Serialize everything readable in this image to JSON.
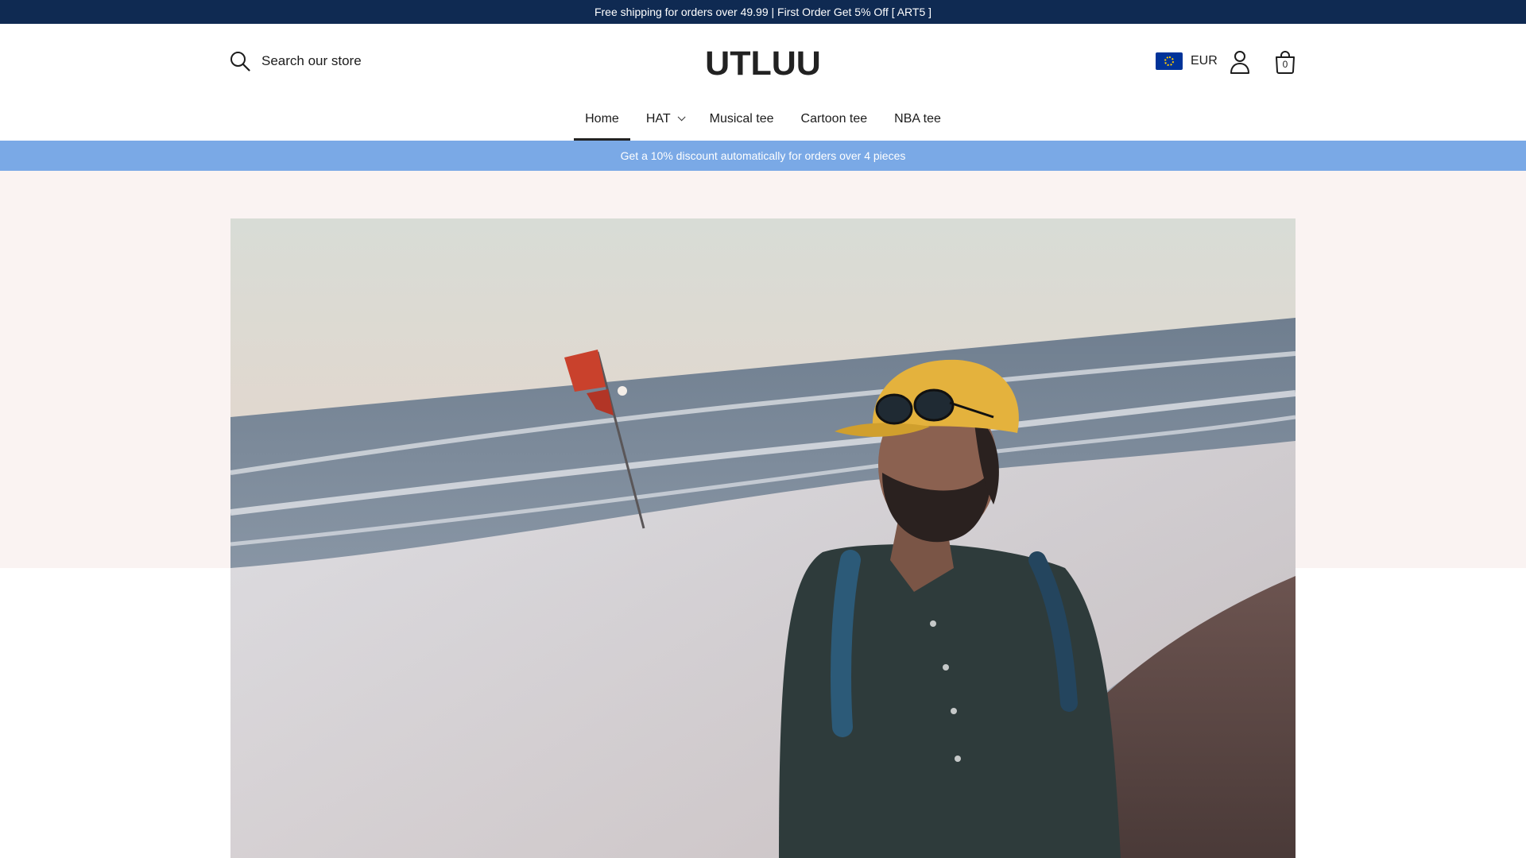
{
  "announcement": {
    "text": "Free shipping for orders over 49.99 | First Order Get 5% Off [ ART5 ]"
  },
  "header": {
    "search_placeholder": "Search our store",
    "logo": "UTLUU",
    "currency": "EUR",
    "cart_count": "0",
    "icons": {
      "search": "search-icon",
      "flag": "eu-flag-icon",
      "account": "account-icon",
      "cart": "shopping-bag-icon"
    }
  },
  "nav": {
    "items": [
      {
        "label": "Home",
        "active": true
      },
      {
        "label": "HAT",
        "has_dropdown": true
      },
      {
        "label": "Musical tee"
      },
      {
        "label": "Cartoon tee"
      },
      {
        "label": "NBA tee"
      }
    ]
  },
  "promo": {
    "text": "Get a 10% discount automatically for orders over 4 pieces"
  },
  "colors": {
    "announcement_bg": "#0f2a52",
    "promo_bg": "#7aa9e6",
    "hero_bg": "#faf3f2"
  }
}
